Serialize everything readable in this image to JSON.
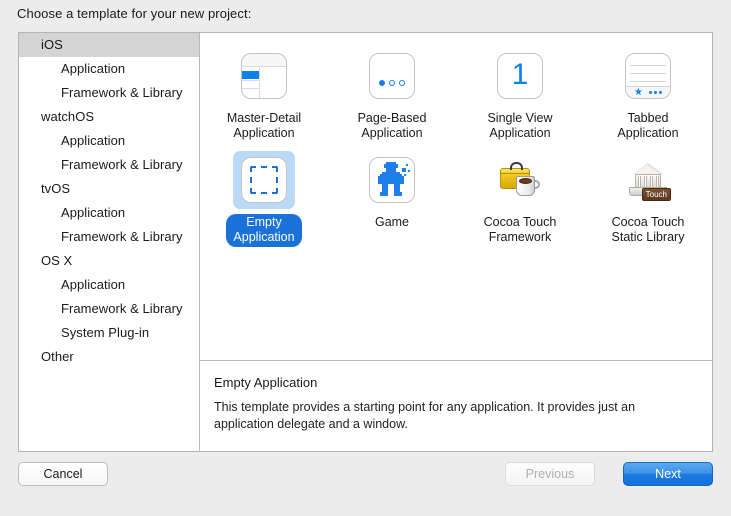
{
  "header": {
    "prompt": "Choose a template for your new project:"
  },
  "sidebar": {
    "items": [
      {
        "label": "iOS",
        "level": "group",
        "selected": true
      },
      {
        "label": "Application",
        "level": "child",
        "selected": false
      },
      {
        "label": "Framework & Library",
        "level": "child",
        "selected": false
      },
      {
        "label": "watchOS",
        "level": "group",
        "selected": false
      },
      {
        "label": "Application",
        "level": "child",
        "selected": false
      },
      {
        "label": "Framework & Library",
        "level": "child",
        "selected": false
      },
      {
        "label": "tvOS",
        "level": "group",
        "selected": false
      },
      {
        "label": "Application",
        "level": "child",
        "selected": false
      },
      {
        "label": "Framework & Library",
        "level": "child",
        "selected": false
      },
      {
        "label": "OS X",
        "level": "group",
        "selected": false
      },
      {
        "label": "Application",
        "level": "child",
        "selected": false
      },
      {
        "label": "Framework & Library",
        "level": "child",
        "selected": false
      },
      {
        "label": "System Plug-in",
        "level": "child",
        "selected": false
      },
      {
        "label": "Other",
        "level": "group",
        "selected": false
      }
    ]
  },
  "templates": {
    "row1": [
      {
        "name": "Master-Detail Application",
        "line1": "Master-Detail",
        "line2": "Application",
        "icon": "master-detail-icon",
        "selected": false
      },
      {
        "name": "Page-Based Application",
        "line1": "Page-Based",
        "line2": "Application",
        "icon": "page-based-icon",
        "selected": false
      },
      {
        "name": "Single View Application",
        "line1": "Single View",
        "line2": "Application",
        "icon": "single-view-icon",
        "glyph": "1",
        "selected": false
      },
      {
        "name": "Tabbed Application",
        "line1": "Tabbed",
        "line2": "Application",
        "icon": "tabbed-icon",
        "selected": false
      }
    ],
    "row2": [
      {
        "name": "Empty Application",
        "line1": "Empty",
        "line2": "Application",
        "icon": "empty-application-icon",
        "selected": true
      },
      {
        "name": "Game",
        "line1": "Game",
        "line2": "",
        "icon": "game-icon",
        "selected": false
      },
      {
        "name": "Cocoa Touch Framework",
        "line1": "Cocoa Touch",
        "line2": "Framework",
        "icon": "cocoa-touch-framework-icon",
        "selected": false
      },
      {
        "name": "Cocoa Touch Static Library",
        "line1": "Cocoa Touch",
        "line2": "Static Library",
        "icon": "cocoa-touch-static-library-icon",
        "badge": "Touch",
        "selected": false
      }
    ]
  },
  "description": {
    "title": "Empty Application",
    "body": "This template provides a starting point for any application. It provides just an application delegate and a window."
  },
  "buttons": {
    "cancel": "Cancel",
    "previous": "Previous",
    "next": "Next"
  },
  "colors": {
    "accent_blue": "#1080ef",
    "selection_fill": "#1a72d8",
    "selection_halo": "#bcd9f5",
    "window_bg": "#ececec",
    "sidebar_selected": "#d4d4d4"
  }
}
